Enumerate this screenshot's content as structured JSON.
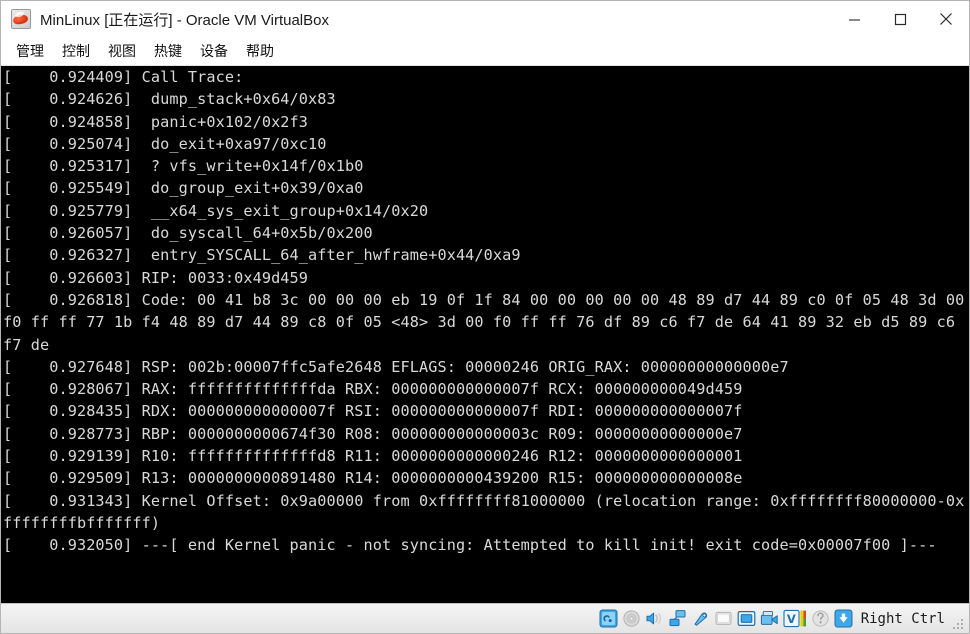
{
  "window": {
    "title": "MinLinux [正在运行] - Oracle VM VirtualBox",
    "app_icon": "virtualbox-icon",
    "controls": [
      {
        "name": "minimize",
        "glyph": "—"
      },
      {
        "name": "maximize",
        "glyph": "▢"
      },
      {
        "name": "close",
        "glyph": "✕"
      }
    ]
  },
  "menubar": {
    "items": [
      {
        "label": "管理"
      },
      {
        "label": "控制"
      },
      {
        "label": "视图"
      },
      {
        "label": "热键"
      },
      {
        "label": "设备"
      },
      {
        "label": "帮助"
      }
    ]
  },
  "console": {
    "background": "#000000",
    "foreground": "#d9d9d9",
    "lines": [
      "[    0.924409] Call Trace:",
      "[    0.924626]  dump_stack+0x64/0x83",
      "[    0.924858]  panic+0x102/0x2f3",
      "[    0.925074]  do_exit+0xa97/0xc10",
      "[    0.925317]  ? vfs_write+0x14f/0x1b0",
      "[    0.925549]  do_group_exit+0x39/0xa0",
      "[    0.925779]  __x64_sys_exit_group+0x14/0x20",
      "[    0.926057]  do_syscall_64+0x5b/0x200",
      "[    0.926327]  entry_SYSCALL_64_after_hwframe+0x44/0xa9",
      "[    0.926603] RIP: 0033:0x49d459",
      "[    0.926818] Code: 00 41 b8 3c 00 00 00 eb 19 0f 1f 84 00 00 00 00 00 48 89 d7 44 89 c0 0f 05 48 3d 00 f0 ff ff 77 1b f4 48 89 d7 44 89 c8 0f 05 <48> 3d 00 f0 ff ff 76 df 89 c6 f7 de 64 41 89 32 eb d5 89 c6 f7 de",
      "[    0.927648] RSP: 002b:00007ffc5afe2648 EFLAGS: 00000246 ORIG_RAX: 00000000000000e7",
      "[    0.928067] RAX: ffffffffffffffda RBX: 000000000000007f RCX: 000000000049d459",
      "[    0.928435] RDX: 000000000000007f RSI: 000000000000007f RDI: 000000000000007f",
      "[    0.928773] RBP: 0000000000674f30 R08: 000000000000003c R09: 00000000000000e7",
      "[    0.929139] R10: ffffffffffffffd8 R11: 0000000000000246 R12: 0000000000000001",
      "[    0.929509] R13: 0000000000891480 R14: 0000000000439200 R15: 000000000000008e",
      "[    0.931343] Kernel Offset: 0x9a00000 from 0xffffffff81000000 (relocation range: 0xffffffff80000000-0xffffffffbfffffff)",
      "[    0.932050] ---[ end Kernel panic - not syncing: Attempted to kill init! exit code=0x00007f00 ]---"
    ]
  },
  "statusbar": {
    "icons": [
      {
        "name": "hard-disk-icon"
      },
      {
        "name": "optical-disk-icon"
      },
      {
        "name": "audio-icon"
      },
      {
        "name": "network-icon"
      },
      {
        "name": "usb-icon"
      },
      {
        "name": "shared-folders-icon"
      },
      {
        "name": "display-icon"
      },
      {
        "name": "recording-icon"
      },
      {
        "name": "virtualbox-features-icon"
      },
      {
        "name": "mouse-integration-icon"
      },
      {
        "name": "host-key-icon"
      }
    ],
    "host_key_label": "Right Ctrl",
    "resize_grip": "resize-grip-icon"
  }
}
